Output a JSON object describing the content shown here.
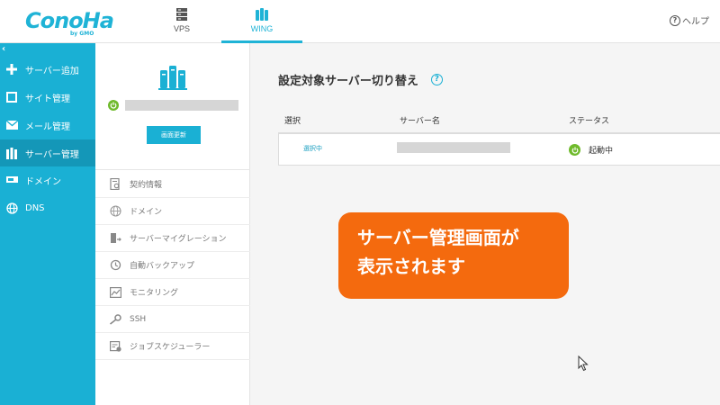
{
  "header": {
    "logo_text": "ConoHa",
    "logo_sub": "by GMO",
    "tabs": [
      {
        "label": "VPS",
        "icon": "server-icon"
      },
      {
        "label": "WING",
        "icon": "wing-server-icon"
      }
    ],
    "help_label": "ヘルプ"
  },
  "sidebar": {
    "collapse": "‹",
    "items": [
      {
        "label": "サーバー追加",
        "icon": "plus-icon"
      },
      {
        "label": "サイト管理",
        "icon": "window-icon"
      },
      {
        "label": "メール管理",
        "icon": "mail-icon"
      },
      {
        "label": "サーバー管理",
        "icon": "server-icon",
        "active": true
      },
      {
        "label": "ドメイン",
        "icon": "domain-icon"
      },
      {
        "label": "DNS",
        "icon": "globe-icon"
      }
    ]
  },
  "panel": {
    "refresh_label": "画面更新",
    "menu": [
      {
        "label": "契約情報",
        "icon": "contract-icon"
      },
      {
        "label": "ドメイン",
        "icon": "domain-icon"
      },
      {
        "label": "サーバーマイグレーション",
        "icon": "migration-icon"
      },
      {
        "label": "自動バックアップ",
        "icon": "backup-icon"
      },
      {
        "label": "モニタリング",
        "icon": "chart-icon"
      },
      {
        "label": "SSH",
        "icon": "key-icon"
      },
      {
        "label": "ジョブスケジューラー",
        "icon": "scheduler-icon"
      }
    ]
  },
  "main": {
    "title": "設定対象サーバー切り替え",
    "help_mark": "?",
    "columns": [
      "選択",
      "サーバー名",
      "ステータス"
    ],
    "rows": [
      {
        "select": "選択中",
        "status": "起動中"
      }
    ]
  },
  "callout": {
    "line1": "サーバー管理画面が",
    "line2": "表示されます"
  },
  "colors": {
    "accent": "#1ab0d4",
    "sidebar_active": "#1497b8",
    "status_on": "#6fba2c",
    "callout": "#f46a0e"
  }
}
